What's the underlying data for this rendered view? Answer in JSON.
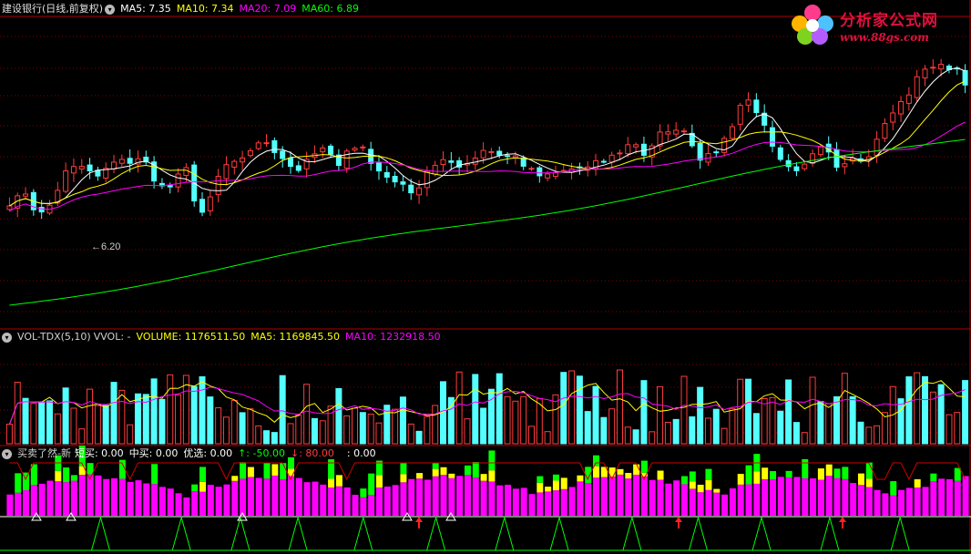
{
  "price_panel": {
    "title": "建设银行(日线,前复权)",
    "ma5": "MA5: 7.35",
    "ma10": "MA10: 7.34",
    "ma20": "MA20: 7.09",
    "ma60": "MA60: 6.89",
    "low_label": "6.20"
  },
  "volume_panel": {
    "title": "VOL-TDX(5,10)",
    "vvol": "VVOL: -",
    "volume": "VOLUME: 1176511.50",
    "ma5": "MA5: 1169845.50",
    "ma10": "MA10: 1232918.50"
  },
  "signal_panel": {
    "title": "买卖了然-新",
    "short_buy": "短买: 0.00",
    "mid_buy": "中买: 0.00",
    "preferred": "优选: 0.00",
    "up": "↑: -50.00",
    "down": "↓: 80.00",
    "extra": ": 0.00"
  },
  "watermark": {
    "name": "分析家公式网",
    "url": "www.88gs.com"
  },
  "colors": {
    "background": "#000000",
    "up_candle": "#ff3c3c",
    "down_candle": "#54ffff",
    "ma5": "#ffffff",
    "ma10": "#ffff00",
    "ma20": "#ff00ff",
    "ma60": "#00ff00",
    "grid": "#800000",
    "separator": "#b00000"
  }
}
